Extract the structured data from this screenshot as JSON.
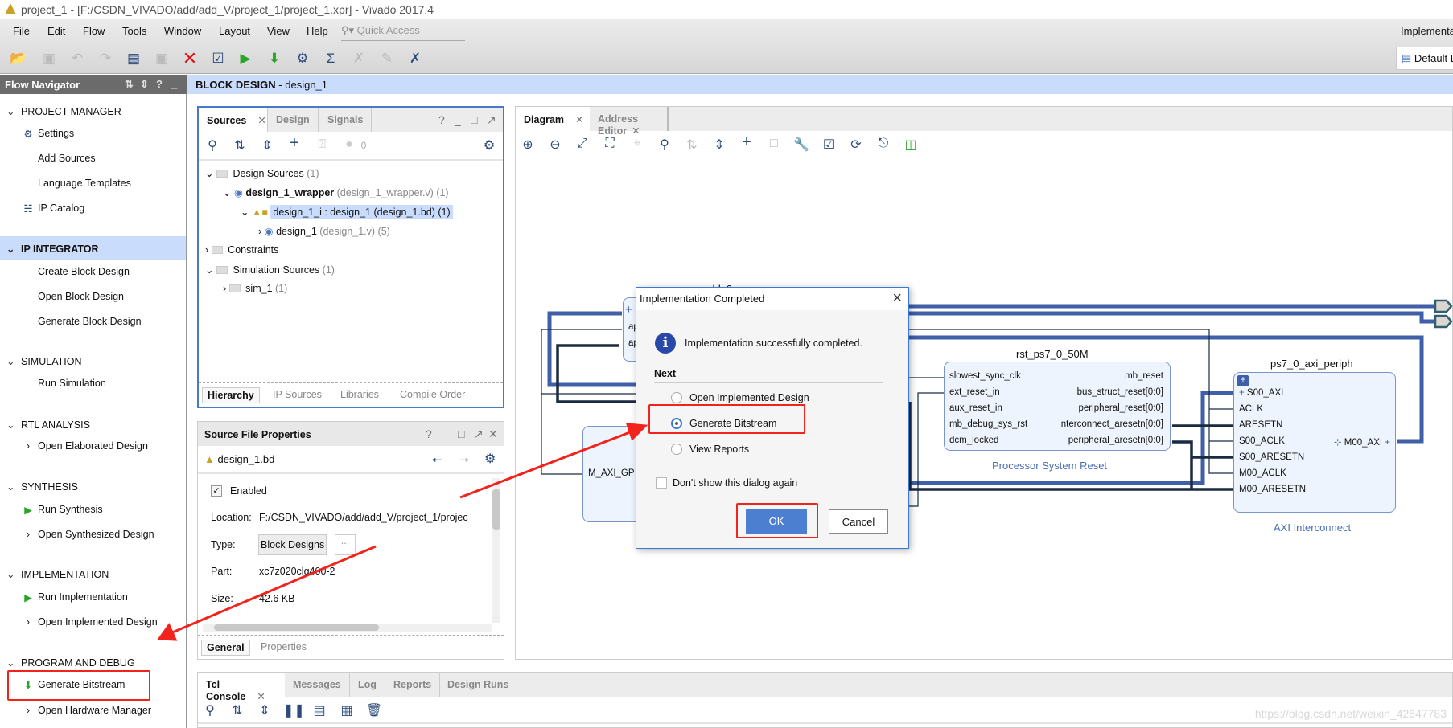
{
  "window": {
    "title": "project_1 - [F:/CSDN_VIVADO/add/add_V/project_1/project_1.xpr] - Vivado 2017.4"
  },
  "menu": [
    "File",
    "Edit",
    "Flow",
    "Tools",
    "Window",
    "Layout",
    "View",
    "Help"
  ],
  "quick_access": {
    "placeholder": "Quick Access"
  },
  "toolbar_icons": [
    "open-project-icon",
    "save-icon",
    "undo-icon",
    "redo-icon",
    "copy-icon",
    "paste-icon",
    "delete-icon",
    "validate-icon",
    "run-icon",
    "bitstream-icon",
    "settings-icon",
    "sigma-icon",
    "disabled-tool-icon",
    "disabled-tool-icon",
    "auto-connect-icon"
  ],
  "status": {
    "run_label": "Implementation Complete",
    "layout": "Default Layout"
  },
  "flow_navigator": {
    "title": "Flow Navigator",
    "sections": [
      {
        "label": "PROJECT MANAGER",
        "items": [
          "Settings",
          "Add Sources",
          "Language Templates",
          "IP Catalog"
        ]
      },
      {
        "label": "IP INTEGRATOR",
        "items": [
          "Create Block Design",
          "Open Block Design",
          "Generate Block Design"
        ]
      },
      {
        "label": "SIMULATION",
        "items": [
          "Run Simulation"
        ]
      },
      {
        "label": "RTL ANALYSIS",
        "items": [
          "Open Elaborated Design"
        ]
      },
      {
        "label": "SYNTHESIS",
        "items": [
          "Run Synthesis",
          "Open Synthesized Design"
        ]
      },
      {
        "label": "IMPLEMENTATION",
        "items": [
          "Run Implementation",
          "Open Implemented Design"
        ]
      },
      {
        "label": "PROGRAM AND DEBUG",
        "items": [
          "Generate Bitstream",
          "Open Hardware Manager"
        ]
      }
    ]
  },
  "header": {
    "section": "BLOCK DESIGN",
    "name": "- design_1"
  },
  "sources": {
    "tabs": [
      "Sources",
      "Design",
      "Signals"
    ],
    "msg_count": "0",
    "tree": [
      {
        "label": "Design Sources",
        "extra": "(1)"
      },
      {
        "label": "design_1_wrapper",
        "extra": "(design_1_wrapper.v) (1)"
      },
      {
        "label": "design_1_i : design_1 (design_1.bd) (1)",
        "extra": ""
      },
      {
        "label": "design_1",
        "extra": "(design_1.v) (5)"
      },
      {
        "label": "Constraints",
        "extra": ""
      },
      {
        "label": "Simulation Sources",
        "extra": "(1)"
      },
      {
        "label": "sim_1",
        "extra": "(1)"
      }
    ],
    "bottom_tabs": [
      "Hierarchy",
      "IP Sources",
      "Libraries",
      "Compile Order"
    ]
  },
  "properties": {
    "title": "Source File Properties",
    "file": "design_1.bd",
    "enabled_label": "Enabled",
    "enabled": true,
    "rows": [
      {
        "label": "Location:",
        "value": "F:/CSDN_VIVADO/add/add_V/project_1/projec"
      },
      {
        "label": "Type:",
        "value": "Block Designs"
      },
      {
        "label": "Part:",
        "value": "xc7z020clg400-2"
      },
      {
        "label": "Size:",
        "value": "42.6 KB"
      }
    ],
    "browse": "...",
    "tabs": [
      "General",
      "Properties"
    ]
  },
  "diagram": {
    "tabs": [
      "Diagram",
      "Address Editor"
    ],
    "blocks": {
      "add": {
        "name": "add_0",
        "pins": [
          "ap",
          "ap"
        ]
      },
      "ps7": {
        "pin": "M_AXI_GP"
      },
      "rst": {
        "name": "rst_ps7_0_50M",
        "type": "Processor System Reset",
        "inputs": [
          "slowest_sync_clk",
          "ext_reset_in",
          "aux_reset_in",
          "mb_debug_sys_rst",
          "dcm_locked"
        ],
        "outputs": [
          "mb_reset",
          "bus_struct_reset[0:0]",
          "peripheral_reset[0:0]",
          "interconnect_aresetn[0:0]",
          "peripheral_aresetn[0:0]"
        ]
      },
      "axi": {
        "name": "ps7_0_axi_periph",
        "type": "AXI Interconnect",
        "inputs": [
          "S00_AXI",
          "ACLK",
          "ARESETN",
          "S00_ACLK",
          "S00_ARESETN",
          "M00_ACLK",
          "M00_ARESETN"
        ],
        "output": "M00_AXI"
      }
    }
  },
  "console": {
    "tabs": [
      "Tcl Console",
      "Messages",
      "Log",
      "Reports",
      "Design Runs"
    ]
  },
  "dialog": {
    "title": "Implementation Completed",
    "message": "Implementation successfully completed.",
    "next_label": "Next",
    "options": [
      "Open Implemented Design",
      "Generate Bitstream",
      "View Reports"
    ],
    "selected": "Generate Bitstream",
    "dont_show": "Don't show this dialog again",
    "ok": "OK",
    "cancel": "Cancel"
  },
  "watermark": "https://blog.csdn.net/weixin_42647783",
  "colors": {
    "accent": "#3c78d8",
    "highlight": "#cadcfb",
    "annotation": "#f2231c",
    "ok_button": "#4d7fd1"
  }
}
